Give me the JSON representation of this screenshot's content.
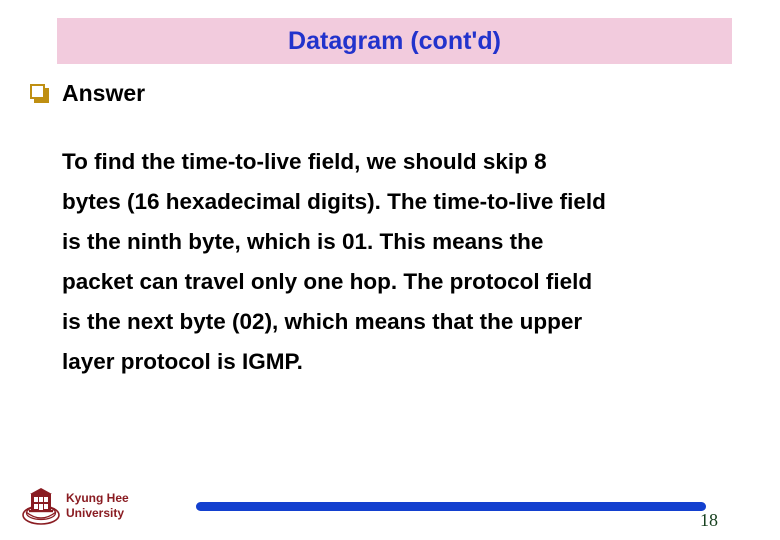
{
  "slide": {
    "title": "Datagram (cont'd)",
    "title_bar_color": "#f2cbdd",
    "title_text_color": "#2233cc"
  },
  "heading": {
    "bullet_icon": "hollow-square-bullet-icon",
    "bullet_color": "#bf8f12",
    "label": "Answer"
  },
  "body": {
    "lines": [
      "To find the time-to-live field, we should skip 8",
      "bytes (16 hexadecimal digits). The time-to-live field",
      "is the ninth byte, which is 01. This means the",
      "packet can travel only one hop. The protocol field",
      "is the next byte (02), which means that the upper",
      "layer protocol is IGMP."
    ]
  },
  "footer": {
    "logo_icon": "university-crest-icon",
    "org_line1": "Kyung Hee",
    "org_line2": "University",
    "org_color": "#8a1c22",
    "rule_color": "#1340cf",
    "page_number": "18",
    "page_number_color": "#16401e"
  }
}
